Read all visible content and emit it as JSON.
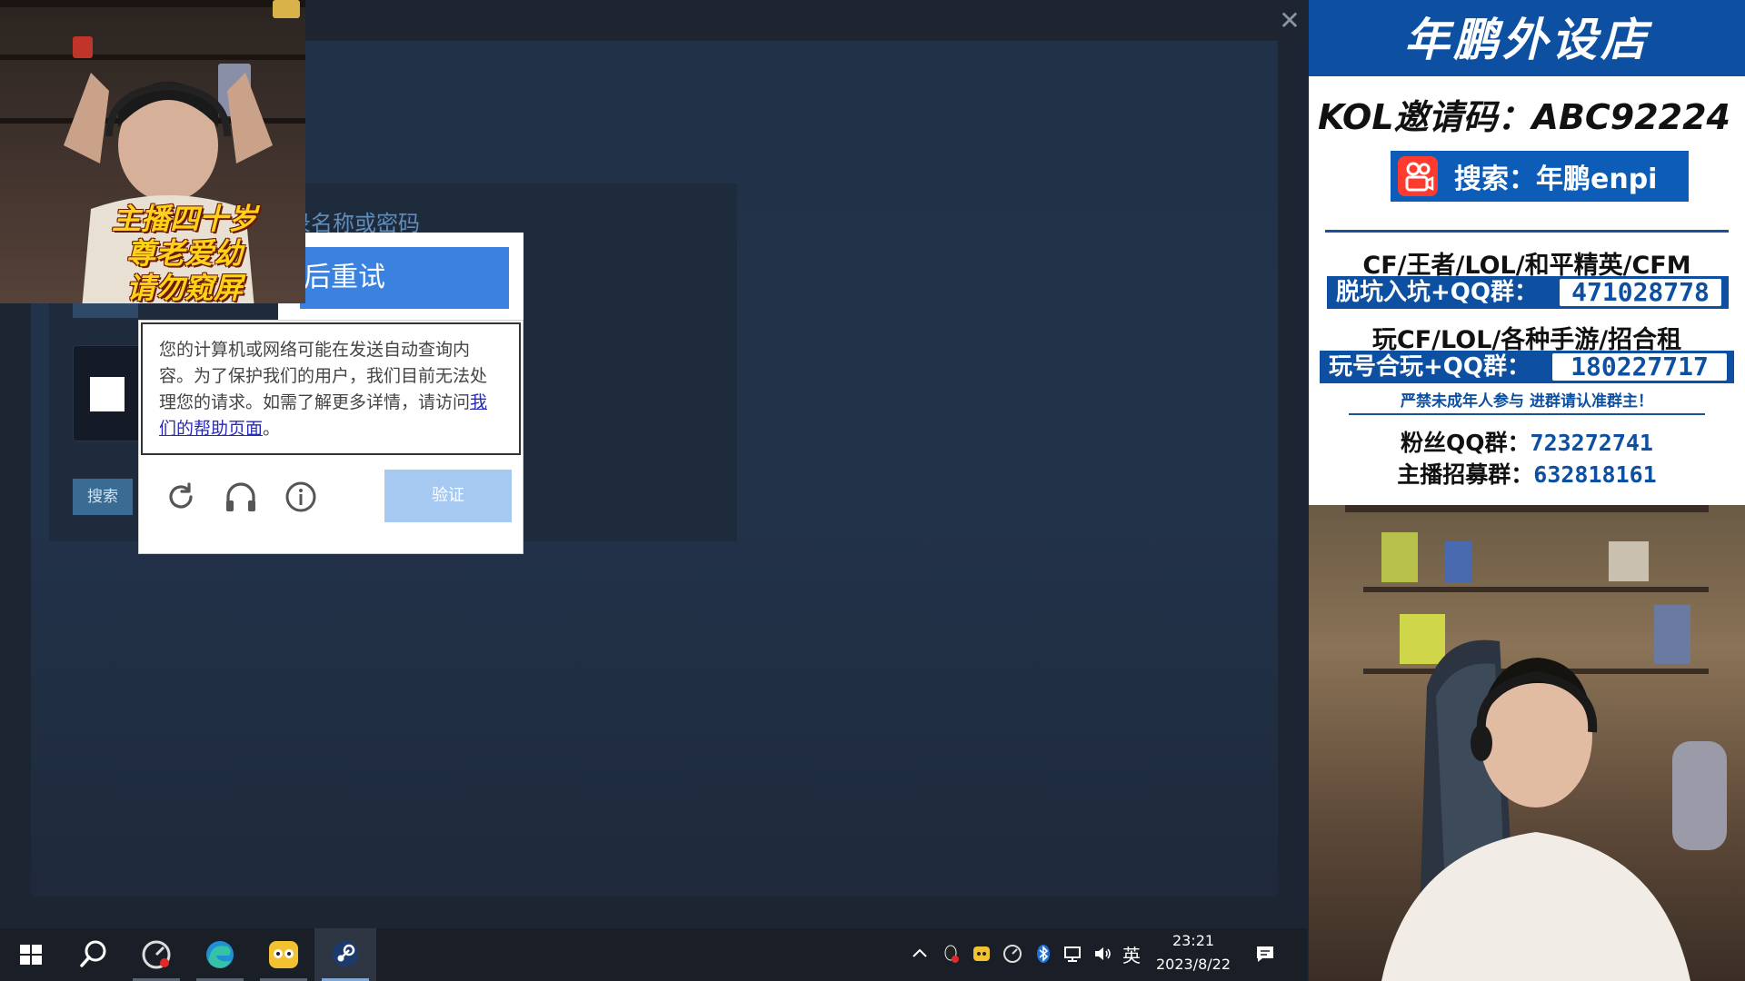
{
  "steam": {
    "close_glyph": "✕",
    "error_message": "户登录名称或密码",
    "search_button": "搜索"
  },
  "captcha": {
    "banner_text": "后重试",
    "message_before_link": "您的计算机或网络可能在发送自动查询内容。为了保护我们的用户，我们目前无法处理您的请求。如需了解更多详情，请访问",
    "link_text": "我们的帮助页面",
    "message_after_link": "。",
    "verify_button": "验证",
    "icons": [
      "refresh-icon",
      "headphones-icon",
      "info-icon"
    ]
  },
  "stream_overlay": {
    "caption_lines": [
      "主播四十岁",
      "尊老爱幼",
      "请勿窥屏"
    ]
  },
  "sidebar_ad": {
    "shop_name": "年鹏外设店",
    "kol_code": "KOL邀请码：ABC92224",
    "search_text": "搜索：年鹏enpi",
    "line1": "CF/王者/LOL/和平精英/CFM",
    "pill1_label": "脱坑入坑+QQ群：",
    "pill1_number": "471028778",
    "line2": "玩CF/LOL/各种手游/招合租",
    "pill2_label": "玩号合玩+QQ群：",
    "pill2_number": "180227717",
    "warning": "严禁未成年人参与  进群请认准群主！",
    "fans_label": "粉丝QQ群：",
    "fans_number": "723272741",
    "recruit_label": "主播招募群：",
    "recruit_number": "632818161",
    "colors": {
      "brand_blue": "#0d4fa0",
      "logo_red": "#ff3b30"
    }
  },
  "taskbar": {
    "apps": [
      "windows-start-icon",
      "search-icon",
      "perf-overlay-icon",
      "edge-icon",
      "game-assistant-icon",
      "steam-icon"
    ],
    "active_app": "steam-icon",
    "tray_icons": [
      "chevron-up-icon",
      "qq-icon",
      "game-helper-icon",
      "perf-overlay-icon",
      "bluetooth-icon",
      "network-icon",
      "volume-icon"
    ],
    "language": "英",
    "time": "23:21",
    "date": "2023/8/22"
  }
}
